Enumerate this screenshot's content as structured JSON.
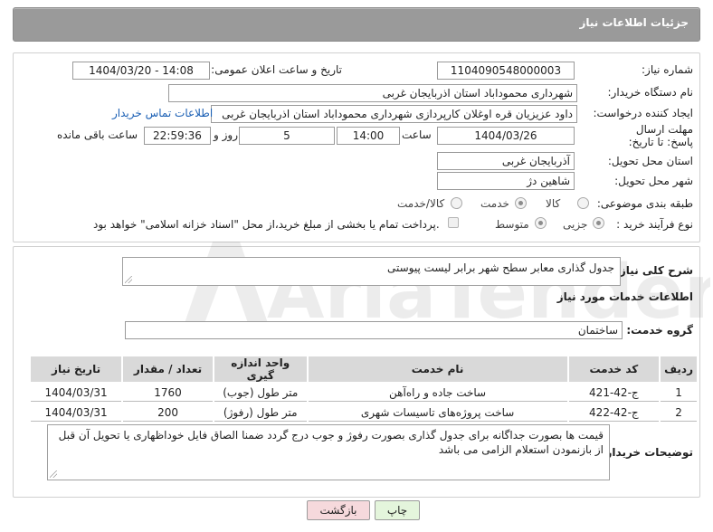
{
  "header": {
    "title": "جزئیات اطلاعات نیاز"
  },
  "form": {
    "need_number": {
      "label": "شماره نیاز:",
      "value": "1104090548000003"
    },
    "announce": {
      "label": "تاریخ و ساعت اعلان عمومی:",
      "value": "1404/03/20 - 14:08"
    },
    "buyer_org": {
      "label": "نام دستگاه خریدار:",
      "value": "شهرداری محموداباد استان اذربایجان غربی"
    },
    "requester": {
      "label": "ایجاد کننده درخواست:",
      "value": "داود عزیزیان قره اوغلان کارپردازی شهرداری محموداباد استان اذربایجان غربی",
      "contact_link": "اطلاعات تماس خریدار"
    },
    "deadline": {
      "label": "مهلت ارسال پاسخ: تا تاریخ:",
      "date": "1404/03/26",
      "time_label": "ساعت",
      "time": "14:00",
      "days": "5",
      "days_label": "روز و",
      "remaining": "22:59:36",
      "remaining_label": "ساعت باقی مانده"
    },
    "province": {
      "label": "استان محل تحویل:",
      "value": "آذربایجان غربی"
    },
    "city": {
      "label": "شهر محل تحویل:",
      "value": "شاهین دژ"
    },
    "category": {
      "label": "طبقه بندی موضوعی:",
      "options": [
        "کالا",
        "خدمت",
        "کالا/خدمت"
      ],
      "selected": "خدمت"
    },
    "process": {
      "label": "نوع فرآیند خرید :",
      "options": [
        "جزیی",
        "متوسط"
      ],
      "selected": "جزیی",
      "payment_note": "پرداخت تمام یا بخشی از مبلغ خرید،از محل \"اسناد خزانه اسلامی\" خواهد بود."
    }
  },
  "summary": {
    "label": "شرح کلی نیاز:",
    "value": "جدول گذاری معابر سطح شهر برابر لیست پیوستی"
  },
  "services": {
    "section_title": "اطلاعات خدمات مورد نیاز",
    "group_label": "گروه خدمت:",
    "group_value": "ساختمان",
    "columns": [
      "ردیف",
      "کد خدمت",
      "نام خدمت",
      "واحد اندازه گیری",
      "تعداد / مقدار",
      "تاریخ نیاز"
    ],
    "rows": [
      {
        "row": "1",
        "code": "ج-42-421",
        "name": "ساخت جاده و راه‌آهن",
        "unit": "متر طول (جوب)",
        "qty": "1760",
        "date": "1404/03/31"
      },
      {
        "row": "2",
        "code": "ج-42-422",
        "name": "ساخت پروژه‌های تاسیسات شهری",
        "unit": "متر طول (رفوژ)",
        "qty": "200",
        "date": "1404/03/31"
      }
    ]
  },
  "buyer_notes": {
    "label": "توضیحات خریدار:",
    "value": "قیمت ها بصورت جداگانه برای جدول گذاری بصورت رفوژ و جوب درج گردد ضمنا الصاق فایل خوداظهاری یا تحویل آن قبل از بازنمودن استعلام الزامی می باشد"
  },
  "buttons": {
    "print": "چاپ",
    "back": "بازگشت"
  },
  "watermark": {
    "text": "AriaTender.neT"
  },
  "colors": {
    "header_bg": "#9a9a9a",
    "link": "#1a5fb4",
    "back_button": "#f6d9dc",
    "print_button": "#e4f5dc"
  }
}
